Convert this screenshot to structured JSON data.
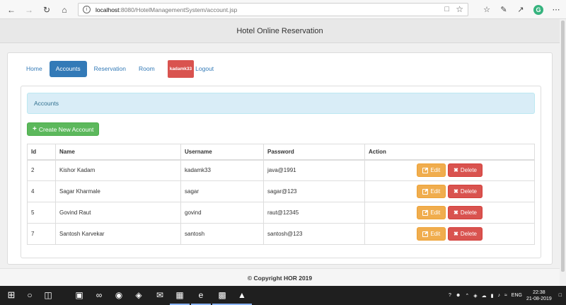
{
  "browser": {
    "url_host": "localhost",
    "url_rest": ":8080/HotelManagementSystem/account.jsp"
  },
  "site": {
    "title": "Hotel Online Reservation"
  },
  "nav": {
    "home": "Home",
    "accounts": "Accounts",
    "reservation": "Reservation",
    "room": "Room",
    "user_badge": "kadamk33",
    "logout": "Logout"
  },
  "accounts_panel": {
    "heading": "Accounts",
    "create_label": "Create New Account"
  },
  "table": {
    "columns": [
      "Id",
      "Name",
      "Username",
      "Password",
      "Action"
    ],
    "rows": [
      {
        "id": "2",
        "name": "Kishor Kadam",
        "username": "kadamk33",
        "password": "java@1991"
      },
      {
        "id": "4",
        "name": "Sagar Kharmale",
        "username": "sagar",
        "password": "sagar@123"
      },
      {
        "id": "5",
        "name": "Govind Raut",
        "username": "govind",
        "password": "raut@12345"
      },
      {
        "id": "7",
        "name": "Santosh Karvekar",
        "username": "santosh",
        "password": "santosh@123"
      }
    ],
    "edit_label": "Edit",
    "delete_label": "Delete"
  },
  "footer": {
    "copyright": "© Copyright HOR 2019"
  },
  "taskbar": {
    "language": "ENG",
    "time": "22:38",
    "date": "21-08-2019"
  },
  "colors": {
    "primary": "#337ab7",
    "success": "#5cb85c",
    "warning": "#f0ad4e",
    "danger": "#d9534f",
    "info_bg": "#d9edf7"
  }
}
